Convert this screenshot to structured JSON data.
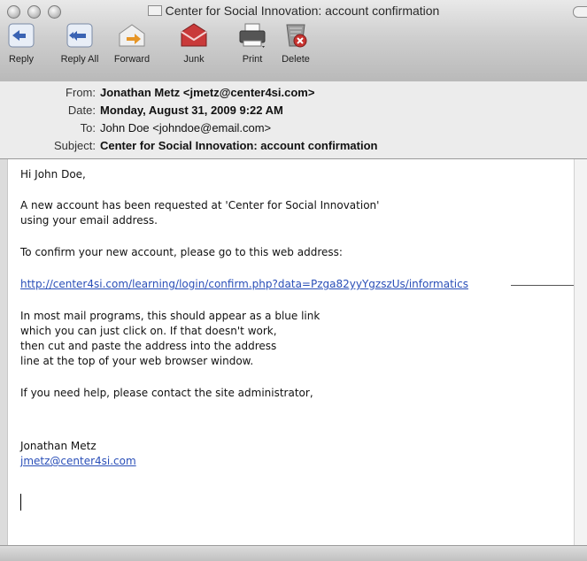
{
  "window": {
    "title": "Center for Social Innovation: account confirmation"
  },
  "toolbar": {
    "reply": "Reply",
    "reply_all": "Reply All",
    "forward": "Forward",
    "junk": "Junk",
    "print": "Print",
    "delete": "Delete"
  },
  "headers": {
    "from_label": "From:",
    "from_name": "Jonathan Metz",
    "from_email": "<jmetz@center4si.com>",
    "date_label": "Date:",
    "date_value": "Monday, August 31, 2009 9:22 AM",
    "to_label": "To:",
    "to_value": "John Doe <johndoe@email.com>",
    "subject_label": "Subject:",
    "subject_value": "Center for Social Innovation: account confirmation"
  },
  "message": {
    "greeting": "Hi John Doe,",
    "p1_line1": "A new account has been requested at 'Center for Social Innovation'",
    "p1_line2": "using your email address.",
    "p2": "To confirm your new account, please go to this web address:",
    "confirm_link": "http://center4si.com/learning/login/confirm.php?data=Pzga82yyYgzszUs/informatics",
    "p3_line1": "In most mail programs, this should appear as a blue link",
    "p3_line2": "which you can just click on.  If that doesn't work,",
    "p3_line3": "then cut and paste the address into the address",
    "p3_line4": "line at the top of your web browser window.",
    "p4": "If you need help, please contact the site administrator,",
    "signature_name": "Jonathan Metz",
    "signature_email": "jmetz@center4si.com"
  }
}
